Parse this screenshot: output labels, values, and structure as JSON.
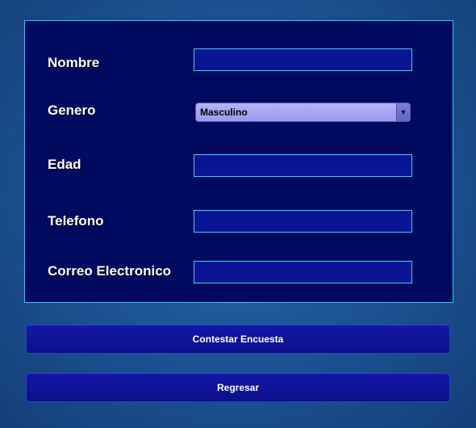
{
  "form": {
    "fields": [
      {
        "label": "Nombre",
        "value": ""
      },
      {
        "label": "Genero",
        "selected": "Masculino"
      },
      {
        "label": "Edad",
        "value": ""
      },
      {
        "label": "Telefono",
        "value": ""
      },
      {
        "label": "Correo Electronico",
        "value": ""
      }
    ],
    "dropdown_icon": "triangle-down-icon"
  },
  "buttons": {
    "submit_label": "Contestar Encuesta",
    "back_label": "Regresar"
  },
  "colors": {
    "panel_bg": "#000a5e",
    "panel_border": "#33c6e0",
    "field_bg": "#0c1496",
    "button_bg": "#1417a6",
    "select_bg": "#a8a8f2",
    "page_bg": "#1d5597"
  }
}
